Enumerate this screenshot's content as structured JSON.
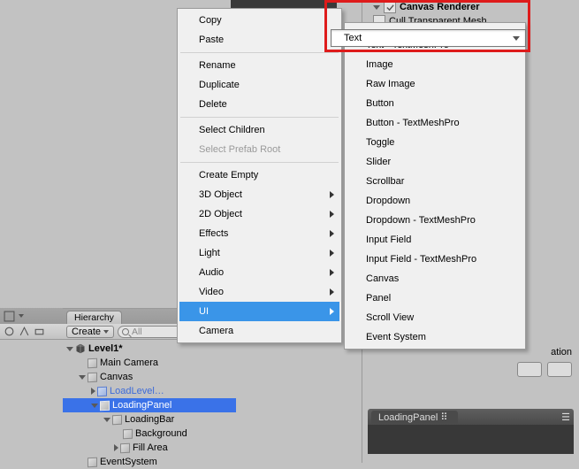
{
  "inspector": {
    "component_label": "Canvas Renderer",
    "cull_label": "Cull Transparent Mesh",
    "right_word": "ation",
    "tab_label": "LoadingPanel"
  },
  "hierarchy": {
    "tab": "Hierarchy",
    "create_label": "Create",
    "search_placeholder": "All",
    "tree": {
      "scene": "Level1*",
      "items": [
        "Main Camera",
        "Canvas",
        "LoadLevel…",
        "LoadingPanel",
        "LoadingBar",
        "Background",
        "Fill Area",
        "EventSystem"
      ]
    }
  },
  "context_menu": {
    "items": [
      "Copy",
      "Paste",
      "Rename",
      "Duplicate",
      "Delete",
      "Select Children",
      "Select Prefab Root",
      "Create Empty",
      "3D Object",
      "2D Object",
      "Effects",
      "Light",
      "Audio",
      "Video",
      "UI",
      "Camera"
    ]
  },
  "ui_submenu": {
    "items": [
      "Text",
      "Text - TextMeshPro",
      "Image",
      "Raw Image",
      "Button",
      "Button - TextMeshPro",
      "Toggle",
      "Slider",
      "Scrollbar",
      "Dropdown",
      "Dropdown - TextMeshPro",
      "Input Field",
      "Input Field - TextMeshPro",
      "Canvas",
      "Panel",
      "Scroll View",
      "Event System"
    ]
  },
  "highlighted_item": "Text"
}
